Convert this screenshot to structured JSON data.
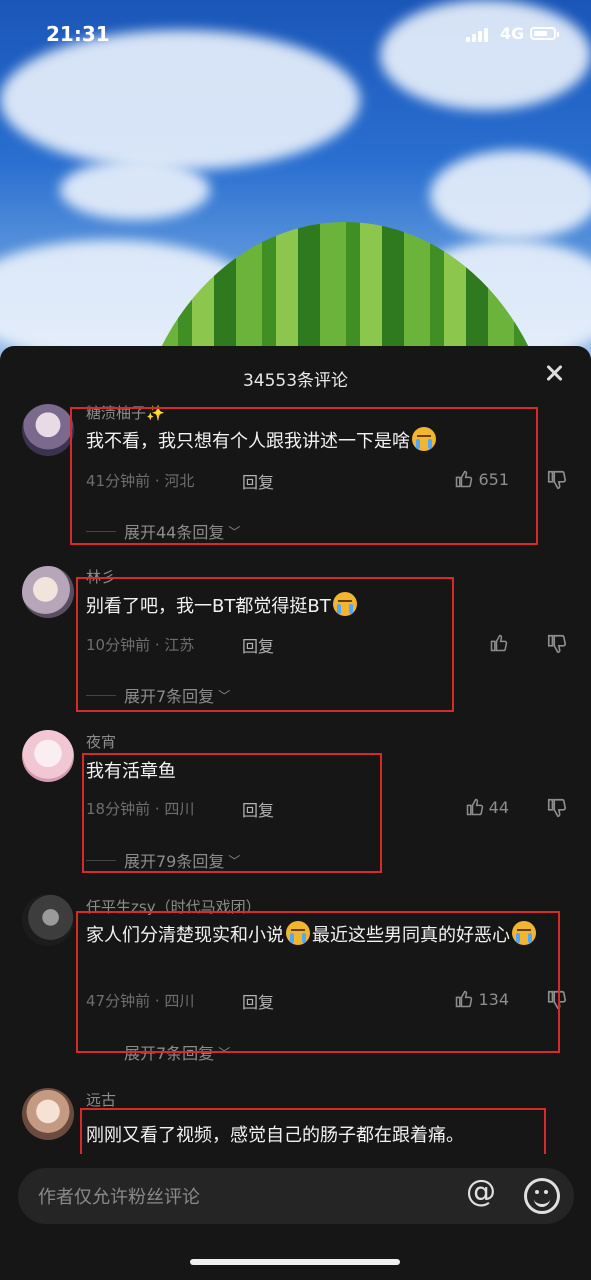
{
  "status_bar": {
    "time": "21:31",
    "network": "4G",
    "battery_percent": 70
  },
  "sheet": {
    "title": "34553条评论"
  },
  "comments": [
    {
      "user": "糖渍柚子✨",
      "text": "我不看，我只想有个人跟我讲述一下是啥",
      "time_location": "41分钟前 · 河北",
      "reply": "回复",
      "likes": "651",
      "expand": "展开44条回复"
    },
    {
      "user": "林彡",
      "text": "别看了吧，我一BT都觉得挺BT",
      "time_location": "10分钟前 · 江苏",
      "reply": "回复",
      "likes": "",
      "expand": "展开7条回复"
    },
    {
      "user": "夜宵",
      "text": "我有活章鱼",
      "time_location": "18分钟前 · 四川",
      "reply": "回复",
      "likes": "44",
      "expand": "展开79条回复"
    },
    {
      "user": "任平生zsy（时代马戏团）",
      "text": "家人们分清楚现实和小说",
      "text2": "最近这些男同真的好恶心",
      "time_location": "47分钟前 · 四川",
      "reply": "回复",
      "likes": "134",
      "expand": "展开7条回复"
    },
    {
      "user": "远古",
      "text": "刚刚又看了视频，感觉自己的肠子都在跟着痛。"
    }
  ],
  "input": {
    "placeholder": "作者仅允许粉丝评论"
  },
  "colors": {
    "highlight_box": "#d72a2a",
    "sheet_bg": "#161616"
  }
}
